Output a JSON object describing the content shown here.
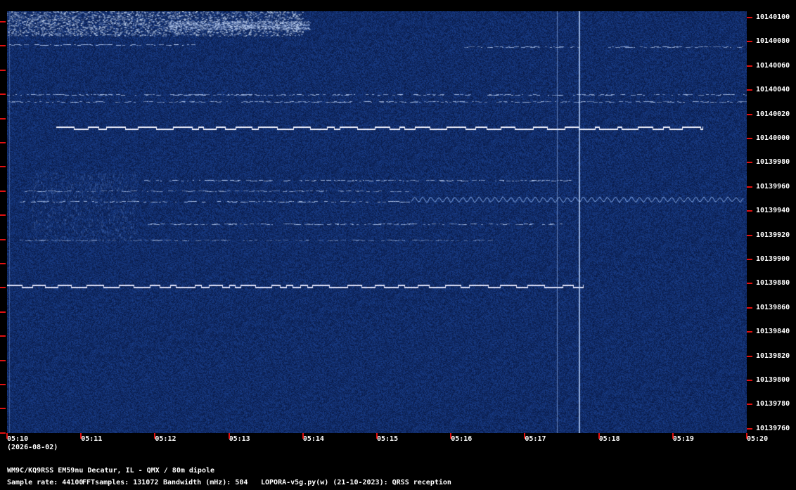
{
  "spectrogram": {
    "frequency_labels": [
      "10140100",
      "10140080",
      "10140060",
      "10140040",
      "10140020",
      "10140000",
      "10139980",
      "10139960",
      "10139940",
      "10139920",
      "10139900",
      "10139880",
      "10139860",
      "10139840",
      "10139820",
      "10139800",
      "10139780",
      "10139760"
    ],
    "time_labels": [
      "05:10",
      "05:11",
      "05:12",
      "05:13",
      "05:14",
      "05:15",
      "05:16",
      "05:17",
      "05:18",
      "05:19",
      "05:20"
    ],
    "date": "(2026-08-02)",
    "colors": {
      "background": "#0a1f4e",
      "signal": "#ffffff",
      "tick": "#e01010"
    }
  },
  "footer": {
    "station": "WM9C/KQ9RSS EM59nu Decatur, IL - QMX / 80m dipole",
    "sample_rate": "Sample rate: 44100",
    "fft_samples": "FFTsamples: 131072",
    "bandwidth": "Bandwidth (mHz): 504",
    "software": "LOPORA-v5g.py(w) (21-10-2023): QRSS reception"
  }
}
